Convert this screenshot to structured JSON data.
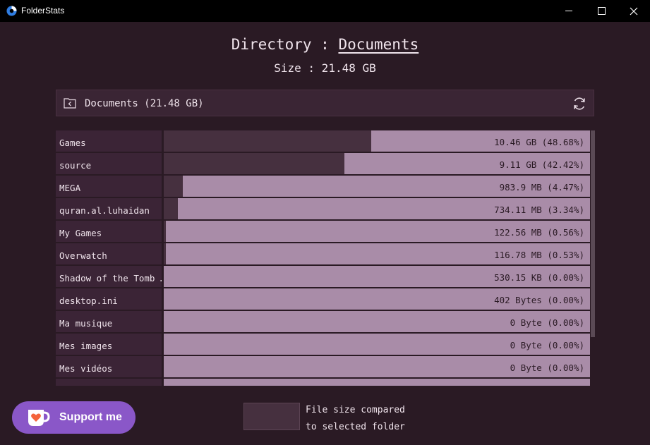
{
  "window": {
    "title": "FolderStats"
  },
  "header": {
    "directory_prefix": "Directory : ",
    "directory_name": "Documents",
    "size_text": "Size : 21.48 GB"
  },
  "pathbar": {
    "label": "Documents (21.48 GB)",
    "back_icon": "folder-back-icon",
    "refresh_icon": "refresh-icon"
  },
  "rows": [
    {
      "name": "Games",
      "size": "10.46 GB (48.68%)",
      "fraction": 0.4868
    },
    {
      "name": "source",
      "size": "9.11 GB (42.42%)",
      "fraction": 0.4242
    },
    {
      "name": "MEGA",
      "size": "983.9 MB (4.47%)",
      "fraction": 0.0447
    },
    {
      "name": "quran.al.luhaidan",
      "size": "734.11 MB (3.34%)",
      "fraction": 0.0334
    },
    {
      "name": "My Games",
      "size": "122.56 MB (0.56%)",
      "fraction": 0.0056
    },
    {
      "name": "Overwatch",
      "size": "116.78 MB (0.53%)",
      "fraction": 0.0053
    },
    {
      "name": "Shadow of the Tomb …",
      "size": "530.15 KB (0.00%)",
      "fraction": 0.0
    },
    {
      "name": "desktop.ini",
      "size": "402 Bytes (0.00%)",
      "fraction": 0.0
    },
    {
      "name": "Ma musique",
      "size": "0 Byte (0.00%)",
      "fraction": 0.0
    },
    {
      "name": "Mes images",
      "size": "0 Byte (0.00%)",
      "fraction": 0.0
    },
    {
      "name": "Mes vidéos",
      "size": "0 Byte (0.00%)",
      "fraction": 0.0
    },
    {
      "name": "",
      "size": "",
      "fraction": 0.0
    }
  ],
  "footer": {
    "support_label": "Support me",
    "legend_line1": "File size compared",
    "legend_line2": "to selected folder"
  },
  "colors": {
    "background": "#2a1a24",
    "bar": "#a98ca8",
    "fill": "#46303f",
    "support": "#8a57c8"
  }
}
